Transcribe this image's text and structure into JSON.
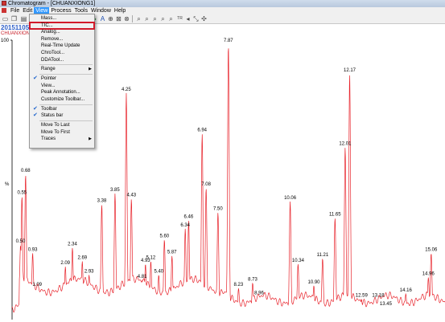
{
  "window": {
    "title": "Chromatogram - [CHUANXIONG1]"
  },
  "menubar": [
    "File",
    "Edit",
    "View",
    "Process",
    "Tools",
    "Window",
    "Help"
  ],
  "toolbar": {
    "tr_label": "TR"
  },
  "header": {
    "date": "20151105",
    "sample": "CHUANXIONG1"
  },
  "axis": {
    "top_label": "100",
    "y_label": "%"
  },
  "view_menu": [
    {
      "label": "Mass...",
      "checked": false,
      "submenu": false
    },
    {
      "label": "TIC...",
      "checked": false,
      "submenu": false,
      "highlighted": true
    },
    {
      "label": "Analog...",
      "checked": false,
      "submenu": false
    },
    {
      "label": "Remove...",
      "checked": false,
      "submenu": false
    },
    {
      "label": "Real-Time Update",
      "checked": false,
      "submenu": false
    },
    {
      "label": "ChroTool...",
      "checked": false,
      "submenu": false
    },
    {
      "label": "DDATool...",
      "checked": false,
      "submenu": false
    },
    {
      "separator": true
    },
    {
      "label": "Range",
      "checked": false,
      "submenu": true
    },
    {
      "separator": true
    },
    {
      "label": "Pointer",
      "checked": true,
      "submenu": false
    },
    {
      "label": "View...",
      "checked": false,
      "submenu": false
    },
    {
      "label": "Peak Annotation...",
      "checked": false,
      "submenu": false
    },
    {
      "label": "Customize Toolbar...",
      "checked": false,
      "submenu": false
    },
    {
      "separator": true
    },
    {
      "label": "Toolbar",
      "checked": true,
      "submenu": false
    },
    {
      "label": "Status bar",
      "checked": true,
      "submenu": false
    },
    {
      "separator": true
    },
    {
      "label": "Move To Last",
      "checked": false,
      "submenu": false
    },
    {
      "label": "Move To First",
      "checked": false,
      "submenu": false
    },
    {
      "label": "Traces",
      "checked": false,
      "submenu": true
    }
  ],
  "chromatogram": {
    "line_color": "#e8232b",
    "peaks": [
      {
        "rt": 0.5,
        "label": "0.50",
        "intensity": 26
      },
      {
        "rt": 0.55,
        "label": "0.55",
        "intensity": 44
      },
      {
        "rt": 0.68,
        "label": "0.68",
        "intensity": 52
      },
      {
        "rt": 0.93,
        "label": "0.93",
        "intensity": 23
      },
      {
        "rt": 1.09,
        "label": "1.09",
        "intensity": 10
      },
      {
        "rt": 2.09,
        "label": "2.09",
        "intensity": 18
      },
      {
        "rt": 2.34,
        "label": "2.34",
        "intensity": 25
      },
      {
        "rt": 2.69,
        "label": "2.69",
        "intensity": 20
      },
      {
        "rt": 2.93,
        "label": "2.93",
        "intensity": 15
      },
      {
        "rt": 3.38,
        "label": "3.38",
        "intensity": 41
      },
      {
        "rt": 3.85,
        "label": "3.85",
        "intensity": 45
      },
      {
        "rt": 4.25,
        "label": "4.25",
        "intensity": 82
      },
      {
        "rt": 4.43,
        "label": "4.43",
        "intensity": 43
      },
      {
        "rt": 4.81,
        "label": "4.81",
        "intensity": 13
      },
      {
        "rt": 4.93,
        "label": "4.93",
        "intensity": 19
      },
      {
        "rt": 5.12,
        "label": "5.12",
        "intensity": 20
      },
      {
        "rt": 5.4,
        "label": "5.40",
        "intensity": 15
      },
      {
        "rt": 5.6,
        "label": "5.60",
        "intensity": 28
      },
      {
        "rt": 5.87,
        "label": "5.87",
        "intensity": 22
      },
      {
        "rt": 6.34,
        "label": "6.34",
        "intensity": 32
      },
      {
        "rt": 6.46,
        "label": "6.46",
        "intensity": 35
      },
      {
        "rt": 6.94,
        "label": "6.94",
        "intensity": 67
      },
      {
        "rt": 7.08,
        "label": "7.08",
        "intensity": 47
      },
      {
        "rt": 7.5,
        "label": "7.50",
        "intensity": 38
      },
      {
        "rt": 7.87,
        "label": "7.87",
        "intensity": 100
      },
      {
        "rt": 8.23,
        "label": "8.23",
        "intensity": 10
      },
      {
        "rt": 8.73,
        "label": "8.73",
        "intensity": 12
      },
      {
        "rt": 8.96,
        "label": "8.96",
        "intensity": 7
      },
      {
        "rt": 10.06,
        "label": "10.06",
        "intensity": 42
      },
      {
        "rt": 10.34,
        "label": "10.34",
        "intensity": 19
      },
      {
        "rt": 10.9,
        "label": "10.90",
        "intensity": 11
      },
      {
        "rt": 11.21,
        "label": "11.21",
        "intensity": 21
      },
      {
        "rt": 11.65,
        "label": "11.65",
        "intensity": 36
      },
      {
        "rt": 12.01,
        "label": "12.01",
        "intensity": 62
      },
      {
        "rt": 12.17,
        "label": "12.17",
        "intensity": 89
      },
      {
        "rt": 12.59,
        "label": "12.59",
        "intensity": 6
      },
      {
        "rt": 13.18,
        "label": "13.18",
        "intensity": 6
      },
      {
        "rt": 13.45,
        "label": "13.45",
        "intensity": 3
      },
      {
        "rt": 14.16,
        "label": "14.16",
        "intensity": 8
      },
      {
        "rt": 14.96,
        "label": "14.96",
        "intensity": 14
      },
      {
        "rt": 15.06,
        "label": "15.06",
        "intensity": 23
      }
    ]
  }
}
